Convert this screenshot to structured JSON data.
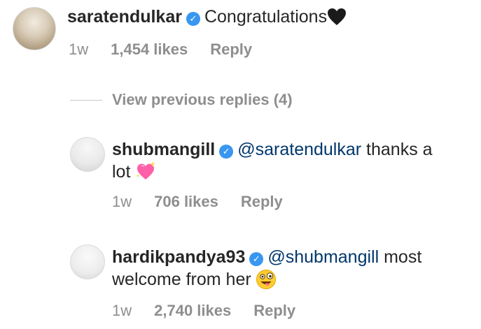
{
  "comments": [
    {
      "username": "saratendulkar",
      "verified": true,
      "text": "Congratulations",
      "emoji": "black-heart",
      "time": "1w",
      "likes": "1,454 likes",
      "reply": "Reply"
    },
    {
      "username": "shubmangill",
      "verified": true,
      "mention": "@saratendulkar",
      "text_line1_rest": " thanks a",
      "text_line2": "lot",
      "emoji": "sparkling-heart",
      "time": "1w",
      "likes": "706 likes",
      "reply": "Reply"
    },
    {
      "username": "hardikpandya93",
      "verified": true,
      "mention": "@shubmangill",
      "text_line1_rest": " most",
      "text_line2": "welcome from her",
      "emoji": "zany-face",
      "time": "1w",
      "likes": "2,740 likes",
      "reply": "Reply"
    }
  ],
  "view_previous": "View previous replies (4)",
  "colors": {
    "text": "#262626",
    "meta": "#8e8e8e",
    "mention": "#00376b",
    "verified": "#3897f0"
  }
}
